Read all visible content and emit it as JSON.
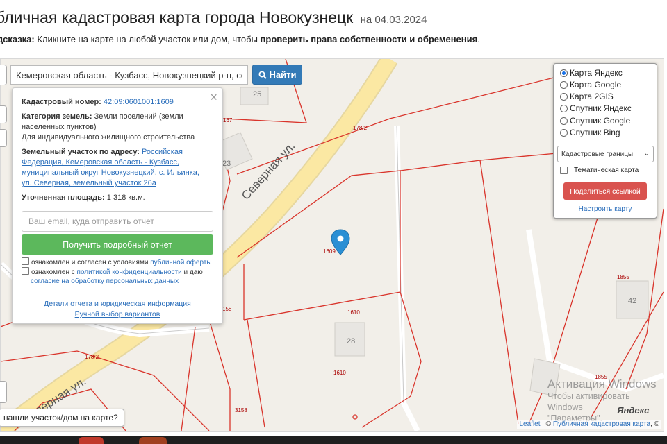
{
  "header": {
    "title": "бличная кадастровая карта города Новокузнецк",
    "date": "на 04.03.2024",
    "hint_label": "дсказка:",
    "hint_text": "Кликните на карте на любой участок или дом, чтобы",
    "hint_bold": "проверить права собственности и обременения",
    "hint_end": "."
  },
  "search": {
    "value": "Кемеровская область - Кузбасс, Новокузнецкий р-н, село Ил",
    "button_label": "Найти"
  },
  "popup": {
    "cadnum_label": "Кадастровый номер:",
    "cadnum_value": "42:09:0601001:1609",
    "category_label": "Категория земель:",
    "category_value": "Земли поселений (земли населенных пунктов)",
    "usage": "Для индивидуального жилищного строительства",
    "address_label": "Земельный участок по адресу:",
    "address_value": "Российская Федерация, Кемеровская область - Кузбасс, муниципальный округ Новокузнецкий, с. Ильинка, ул. Северная, земельный участок 26а",
    "area_label": "Уточненная площадь:",
    "area_value": "1 318 кв.м.",
    "email_placeholder": "Ваш email, куда отправить отчет",
    "report_button": "Получить подробный отчет",
    "consent1_text": "ознакомлен и согласен с условиями",
    "consent1_link": "публичной оферты",
    "consent2_text": "ознакомлен с",
    "consent2_link1": "политикой конфиденциальности",
    "consent2_mid": "и даю",
    "consent2_link2": "согласие на обработку персональных данных",
    "details_link": "Детали отчета и юридическая информация",
    "manual_link": "Ручной выбор вариантов",
    "close": "×"
  },
  "layers": {
    "options": [
      {
        "label": "Карта Яндекс",
        "selected": true
      },
      {
        "label": "Карта Google",
        "selected": false
      },
      {
        "label": "Карта 2GIS",
        "selected": false
      },
      {
        "label": "Спутник Яндекс",
        "selected": false
      },
      {
        "label": "Спутник Google",
        "selected": false
      },
      {
        "label": "Спутник Bing",
        "selected": false
      }
    ],
    "select_value": "Кадастровые границы",
    "thematic_label": "Тематическая карта",
    "share_button": "Поделиться ссылкой",
    "configure_link": "Настроить карту"
  },
  "map": {
    "street_name": "Северная ул.",
    "road_code": "178/2",
    "parcel_labels": [
      "1609",
      "1610",
      "1610",
      "1855",
      "1855",
      "3158",
      "158",
      "167"
    ],
    "house_numbers": [
      "25",
      "23",
      "28",
      "42"
    ],
    "accent_red": "#d9342b",
    "road_color": "#fbe8a3"
  },
  "footer": {
    "question": "нашли участок/дом на карте?",
    "attrib_leaflet": "Leaflet",
    "attrib_sep": "| ©",
    "attrib_pkk": "Публичная кадастровая карта",
    "attrib_end": ", ©",
    "yandex_logo": "Яндекс",
    "windows_title": "Активация Windows",
    "windows_sub1": "Чтобы активировать Windows",
    "windows_sub2": "\"Параметры\"."
  }
}
